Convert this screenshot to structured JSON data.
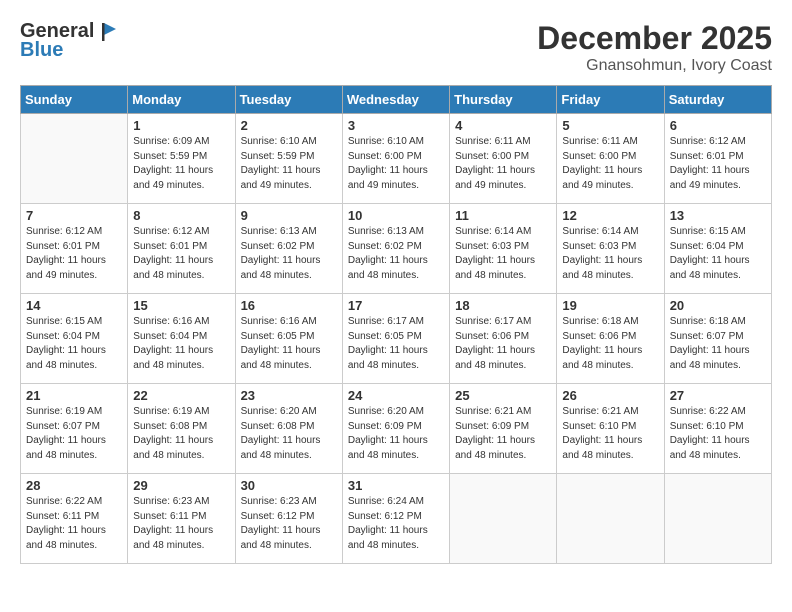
{
  "header": {
    "logo_general": "General",
    "logo_blue": "Blue",
    "month": "December 2025",
    "location": "Gnansohmun, Ivory Coast"
  },
  "days": [
    "Sunday",
    "Monday",
    "Tuesday",
    "Wednesday",
    "Thursday",
    "Friday",
    "Saturday"
  ],
  "weeks": [
    [
      {
        "num": "",
        "info": ""
      },
      {
        "num": "1",
        "info": "Sunrise: 6:09 AM\nSunset: 5:59 PM\nDaylight: 11 hours\nand 49 minutes."
      },
      {
        "num": "2",
        "info": "Sunrise: 6:10 AM\nSunset: 5:59 PM\nDaylight: 11 hours\nand 49 minutes."
      },
      {
        "num": "3",
        "info": "Sunrise: 6:10 AM\nSunset: 6:00 PM\nDaylight: 11 hours\nand 49 minutes."
      },
      {
        "num": "4",
        "info": "Sunrise: 6:11 AM\nSunset: 6:00 PM\nDaylight: 11 hours\nand 49 minutes."
      },
      {
        "num": "5",
        "info": "Sunrise: 6:11 AM\nSunset: 6:00 PM\nDaylight: 11 hours\nand 49 minutes."
      },
      {
        "num": "6",
        "info": "Sunrise: 6:12 AM\nSunset: 6:01 PM\nDaylight: 11 hours\nand 49 minutes."
      }
    ],
    [
      {
        "num": "7",
        "info": "Sunrise: 6:12 AM\nSunset: 6:01 PM\nDaylight: 11 hours\nand 49 minutes."
      },
      {
        "num": "8",
        "info": "Sunrise: 6:12 AM\nSunset: 6:01 PM\nDaylight: 11 hours\nand 48 minutes."
      },
      {
        "num": "9",
        "info": "Sunrise: 6:13 AM\nSunset: 6:02 PM\nDaylight: 11 hours\nand 48 minutes."
      },
      {
        "num": "10",
        "info": "Sunrise: 6:13 AM\nSunset: 6:02 PM\nDaylight: 11 hours\nand 48 minutes."
      },
      {
        "num": "11",
        "info": "Sunrise: 6:14 AM\nSunset: 6:03 PM\nDaylight: 11 hours\nand 48 minutes."
      },
      {
        "num": "12",
        "info": "Sunrise: 6:14 AM\nSunset: 6:03 PM\nDaylight: 11 hours\nand 48 minutes."
      },
      {
        "num": "13",
        "info": "Sunrise: 6:15 AM\nSunset: 6:04 PM\nDaylight: 11 hours\nand 48 minutes."
      }
    ],
    [
      {
        "num": "14",
        "info": "Sunrise: 6:15 AM\nSunset: 6:04 PM\nDaylight: 11 hours\nand 48 minutes."
      },
      {
        "num": "15",
        "info": "Sunrise: 6:16 AM\nSunset: 6:04 PM\nDaylight: 11 hours\nand 48 minutes."
      },
      {
        "num": "16",
        "info": "Sunrise: 6:16 AM\nSunset: 6:05 PM\nDaylight: 11 hours\nand 48 minutes."
      },
      {
        "num": "17",
        "info": "Sunrise: 6:17 AM\nSunset: 6:05 PM\nDaylight: 11 hours\nand 48 minutes."
      },
      {
        "num": "18",
        "info": "Sunrise: 6:17 AM\nSunset: 6:06 PM\nDaylight: 11 hours\nand 48 minutes."
      },
      {
        "num": "19",
        "info": "Sunrise: 6:18 AM\nSunset: 6:06 PM\nDaylight: 11 hours\nand 48 minutes."
      },
      {
        "num": "20",
        "info": "Sunrise: 6:18 AM\nSunset: 6:07 PM\nDaylight: 11 hours\nand 48 minutes."
      }
    ],
    [
      {
        "num": "21",
        "info": "Sunrise: 6:19 AM\nSunset: 6:07 PM\nDaylight: 11 hours\nand 48 minutes."
      },
      {
        "num": "22",
        "info": "Sunrise: 6:19 AM\nSunset: 6:08 PM\nDaylight: 11 hours\nand 48 minutes."
      },
      {
        "num": "23",
        "info": "Sunrise: 6:20 AM\nSunset: 6:08 PM\nDaylight: 11 hours\nand 48 minutes."
      },
      {
        "num": "24",
        "info": "Sunrise: 6:20 AM\nSunset: 6:09 PM\nDaylight: 11 hours\nand 48 minutes."
      },
      {
        "num": "25",
        "info": "Sunrise: 6:21 AM\nSunset: 6:09 PM\nDaylight: 11 hours\nand 48 minutes."
      },
      {
        "num": "26",
        "info": "Sunrise: 6:21 AM\nSunset: 6:10 PM\nDaylight: 11 hours\nand 48 minutes."
      },
      {
        "num": "27",
        "info": "Sunrise: 6:22 AM\nSunset: 6:10 PM\nDaylight: 11 hours\nand 48 minutes."
      }
    ],
    [
      {
        "num": "28",
        "info": "Sunrise: 6:22 AM\nSunset: 6:11 PM\nDaylight: 11 hours\nand 48 minutes."
      },
      {
        "num": "29",
        "info": "Sunrise: 6:23 AM\nSunset: 6:11 PM\nDaylight: 11 hours\nand 48 minutes."
      },
      {
        "num": "30",
        "info": "Sunrise: 6:23 AM\nSunset: 6:12 PM\nDaylight: 11 hours\nand 48 minutes."
      },
      {
        "num": "31",
        "info": "Sunrise: 6:24 AM\nSunset: 6:12 PM\nDaylight: 11 hours\nand 48 minutes."
      },
      {
        "num": "",
        "info": ""
      },
      {
        "num": "",
        "info": ""
      },
      {
        "num": "",
        "info": ""
      }
    ]
  ]
}
